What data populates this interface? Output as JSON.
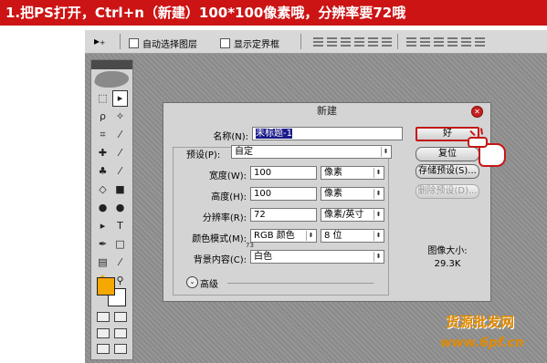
{
  "banner": {
    "text": "1.把PS打开，Ctrl+n（新建）100*100像素哦，分辨率要72哦"
  },
  "options_bar": {
    "tool_icon": "move-tool-icon",
    "auto_select_label": "自动选择图层",
    "show_bounds_label": "显示定界框"
  },
  "dialog": {
    "title": "新建",
    "name_label": "名称(N):",
    "name_value": "未标题-1",
    "preset_label": "预设(P):",
    "preset_value": "自定",
    "width_label": "宽度(W):",
    "width_value": "100",
    "width_unit": "像素",
    "height_label": "高度(H):",
    "height_value": "100",
    "height_unit": "像素",
    "resolution_label": "分辨率(R):",
    "resolution_value": "72",
    "resolution_unit": "像素/英寸",
    "color_mode_label": "颜色模式(M):",
    "color_mode_value": "RGB 颜色",
    "bit_depth_value": "8 位",
    "bg_label": "背景内容(C):",
    "bg_value": "白色",
    "advanced_label": "高级",
    "ok_label": "好",
    "reset_label": "复位",
    "save_preset_label": "存储预设(S)...",
    "delete_preset_label": "删除预设(D)...",
    "image_size_label": "图像大小:",
    "image_size_value": "29.3K",
    "cursor_number": "73"
  },
  "watermark": {
    "text": "货源批发网",
    "url": "www.6pf.cn"
  },
  "colors": {
    "banner": "#cc1414",
    "foreground": "#f5a800",
    "highlight": "#c41717",
    "watermark": "#e08a00"
  }
}
